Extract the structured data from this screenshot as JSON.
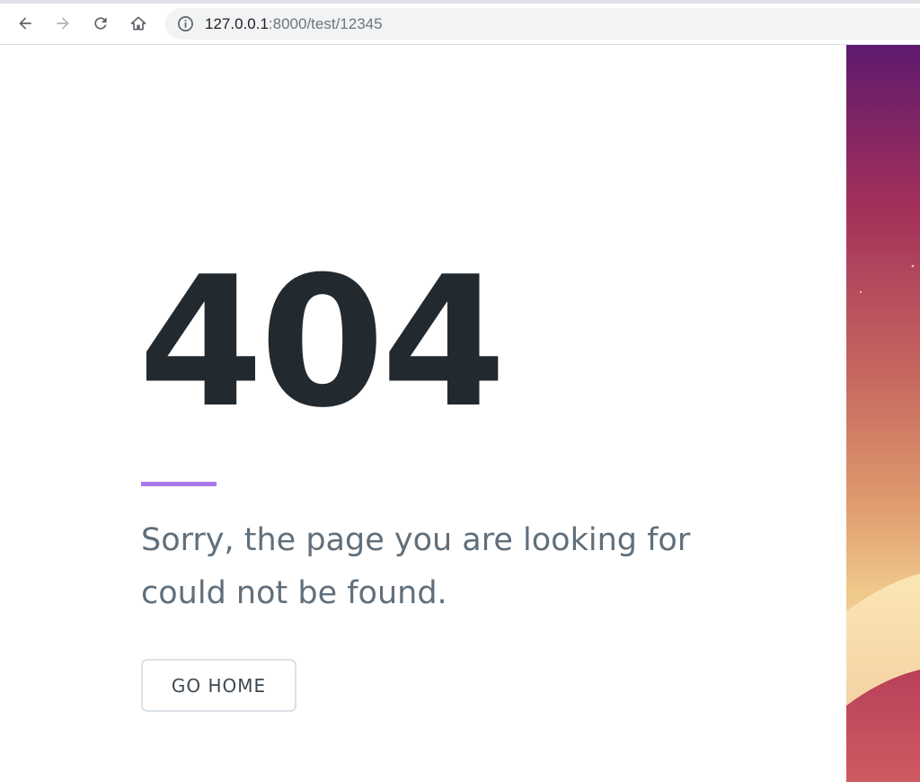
{
  "browser": {
    "url_host": "127.0.0.1",
    "url_rest": ":8000/test/12345",
    "icons": [
      "back-arrow-icon",
      "forward-arrow-icon",
      "reload-icon",
      "home-icon",
      "site-info-icon"
    ]
  },
  "page": {
    "error_code": "404",
    "message": "Sorry, the page you are looking for could not be found.",
    "home_button_label": "GO HOME",
    "colors": {
      "code_text": "#22292f",
      "divider": "#a779e9",
      "message_text": "#606f7b",
      "button_border": "#dae1e7"
    }
  }
}
